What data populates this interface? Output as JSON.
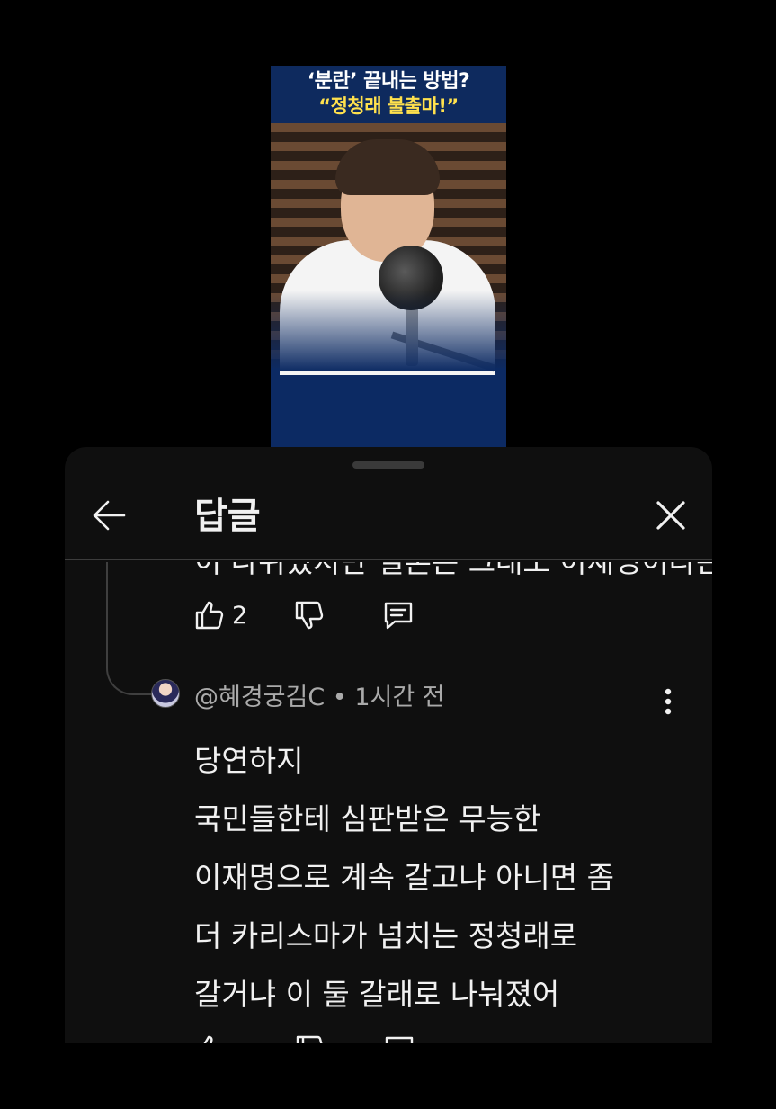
{
  "video": {
    "title_line1": "‘분란’ 끝내는 방법?",
    "title_line2": "“정청래 불출마!”"
  },
  "header": {
    "title": "답글",
    "back_icon": "arrow-left-icon",
    "close_icon": "close-icon"
  },
  "previous_reply": {
    "cut_text": "이 나뉘었지만 결론은 그래도 이재명이라는",
    "like_count": "2"
  },
  "reply": {
    "author": "@혜경궁김C",
    "separator": " • ",
    "time": "1시간 전",
    "lines": [
      "당연하지",
      "국민들한테 심판받은 무능한",
      "이재명으로 계속 갈고냐 아니면 좀",
      "더 카리스마가 넘치는 정청래로",
      "갈거냐 이 둘 갈래로 나눠졌어"
    ]
  },
  "colors": {
    "sheet_bg": "#0f0f0f",
    "text_primary": "#f1f1f1",
    "text_secondary": "#aaaaaa",
    "divider": "#3d3d3d"
  }
}
